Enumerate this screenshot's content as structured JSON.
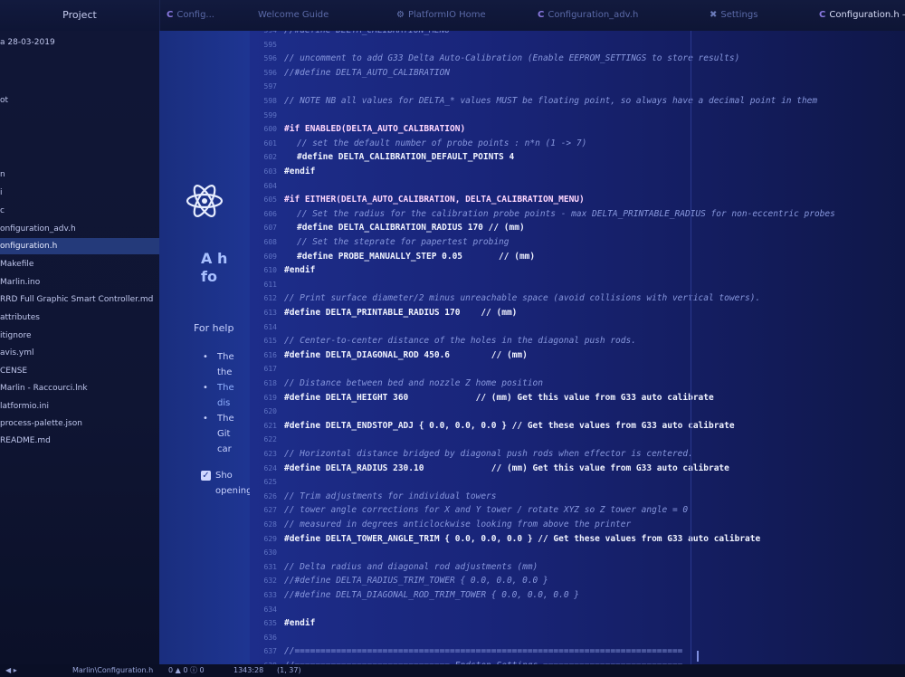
{
  "tabs": {
    "project": "Project",
    "items": [
      {
        "label": "Config...",
        "icon": "c-file-icon"
      },
      {
        "label": "Welcome Guide",
        "icon": ""
      },
      {
        "label": "PlatformIO Home",
        "icon": "platformio-icon"
      },
      {
        "label": "Configuration_adv.h",
        "icon": "c-file-icon"
      },
      {
        "label": "Settings",
        "icon": "gear-icon"
      },
      {
        "label": "Configuration.h —",
        "icon": "c-file-icon"
      }
    ]
  },
  "sidebar": {
    "items": [
      {
        "label": "a 28-03-2019",
        "selected": false
      },
      {
        "label": "ot",
        "selected": false
      },
      {
        "label": "n",
        "selected": false
      },
      {
        "label": "i",
        "selected": false
      },
      {
        "label": "c",
        "selected": false
      },
      {
        "label": "onfiguration_adv.h",
        "selected": false
      },
      {
        "label": "onfiguration.h",
        "selected": true
      },
      {
        "label": "Makefile",
        "selected": false
      },
      {
        "label": "Marlin.ino",
        "selected": false
      },
      {
        "label": "RRD Full Graphic Smart Controller.md",
        "selected": false
      },
      {
        "label": "attributes",
        "selected": false
      },
      {
        "label": "itignore",
        "selected": false
      },
      {
        "label": "avis.yml",
        "selected": false
      },
      {
        "label": "CENSE",
        "selected": false
      },
      {
        "label": "Marlin - Raccourci.lnk",
        "selected": false
      },
      {
        "label": "latformio.ini",
        "selected": false
      },
      {
        "label": "process-palette.json",
        "selected": false
      },
      {
        "label": "README.md",
        "selected": false
      }
    ]
  },
  "welcome": {
    "title": "A h\nfo",
    "for_help": "For help",
    "bullets": [
      "The\nthe",
      "The\ndis",
      "The\nGit\ncar"
    ],
    "checkbox_label": "Sho\nopening"
  },
  "editor": {
    "lines": [
      {
        "num": "594",
        "text": "//#define DELTA_CALIBRATION_MENU",
        "kind": "cm",
        "indent": 0
      },
      {
        "num": "595",
        "text": "",
        "kind": "code",
        "indent": 0
      },
      {
        "num": "596",
        "text": "// uncomment to add G33 Delta Auto-Calibration (Enable EEPROM_SETTINGS to store results)",
        "kind": "cm",
        "indent": 0
      },
      {
        "num": "596",
        "text": "//#define DELTA_AUTO_CALIBRATION",
        "kind": "cm",
        "indent": 0
      },
      {
        "num": "597",
        "text": "",
        "kind": "code",
        "indent": 0
      },
      {
        "num": "598",
        "text": "// NOTE NB all values for DELTA_* values MUST be floating point, so always have a decimal point in them",
        "kind": "cm",
        "indent": 0
      },
      {
        "num": "599",
        "text": "",
        "kind": "code",
        "indent": 0
      },
      {
        "num": "600",
        "text": "#if ENABLED(DELTA_AUTO_CALIBRATION)",
        "kind": "kw",
        "indent": 0
      },
      {
        "num": "601",
        "text": "// set the default number of probe points : n*n (1 -> 7)",
        "kind": "cm",
        "indent": 1
      },
      {
        "num": "602",
        "text": "#define DELTA_CALIBRATION_DEFAULT_POINTS 4",
        "kind": "pp",
        "indent": 1
      },
      {
        "num": "603",
        "text": "#endif",
        "kind": "pp",
        "indent": 0
      },
      {
        "num": "604",
        "text": "",
        "kind": "code",
        "indent": 0
      },
      {
        "num": "605",
        "text": "#if EITHER(DELTA_AUTO_CALIBRATION, DELTA_CALIBRATION_MENU)",
        "kind": "kw",
        "indent": 0
      },
      {
        "num": "606",
        "text": "// Set the radius for the calibration probe points - max DELTA_PRINTABLE_RADIUS for non-eccentric probes",
        "kind": "cm",
        "indent": 1
      },
      {
        "num": "607",
        "text": "#define DELTA_CALIBRATION_RADIUS 170 // (mm)",
        "kind": "pp",
        "indent": 1
      },
      {
        "num": "608",
        "text": "// Set the steprate for papertest probing",
        "kind": "cm",
        "indent": 1
      },
      {
        "num": "609",
        "text": "#define PROBE_MANUALLY_STEP 0.05       // (mm)",
        "kind": "pp",
        "indent": 1
      },
      {
        "num": "610",
        "text": "#endif",
        "kind": "pp",
        "indent": 0
      },
      {
        "num": "611",
        "text": "",
        "kind": "code",
        "indent": 0
      },
      {
        "num": "612",
        "text": "// Print surface diameter/2 minus unreachable space (avoid collisions with vertical towers).",
        "kind": "cm",
        "indent": 0
      },
      {
        "num": "613",
        "text": "#define DELTA_PRINTABLE_RADIUS 170    // (mm)",
        "kind": "pp",
        "indent": 0
      },
      {
        "num": "614",
        "text": "",
        "kind": "code",
        "indent": 0
      },
      {
        "num": "615",
        "text": "// Center-to-center distance of the holes in the diagonal push rods.",
        "kind": "cm",
        "indent": 0
      },
      {
        "num": "616",
        "text": "#define DELTA_DIAGONAL_ROD 450.6        // (mm)",
        "kind": "pp",
        "indent": 0
      },
      {
        "num": "617",
        "text": "",
        "kind": "code",
        "indent": 0
      },
      {
        "num": "618",
        "text": "// Distance between bed and nozzle Z home position",
        "kind": "cm",
        "indent": 0
      },
      {
        "num": "619",
        "text": "#define DELTA_HEIGHT 360             // (mm) Get this value from G33 auto calibrate",
        "kind": "pp",
        "indent": 0
      },
      {
        "num": "620",
        "text": "",
        "kind": "code",
        "indent": 0
      },
      {
        "num": "621",
        "text": "#define DELTA_ENDSTOP_ADJ { 0.0, 0.0, 0.0 } // Get these values from G33 auto calibrate",
        "kind": "pp",
        "indent": 0
      },
      {
        "num": "622",
        "text": "",
        "kind": "code",
        "indent": 0
      },
      {
        "num": "623",
        "text": "// Horizontal distance bridged by diagonal push rods when effector is centered.",
        "kind": "cm",
        "indent": 0
      },
      {
        "num": "624",
        "text": "#define DELTA_RADIUS 230.10             // (mm) Get this value from G33 auto calibrate",
        "kind": "pp",
        "indent": 0
      },
      {
        "num": "625",
        "text": "",
        "kind": "code",
        "indent": 0
      },
      {
        "num": "626",
        "text": "// Trim adjustments for individual towers",
        "kind": "cm",
        "indent": 0
      },
      {
        "num": "627",
        "text": "// tower angle corrections for X and Y tower / rotate XYZ so Z tower angle = 0",
        "kind": "cm",
        "indent": 0
      },
      {
        "num": "628",
        "text": "// measured in degrees anticlockwise looking from above the printer",
        "kind": "cm",
        "indent": 0
      },
      {
        "num": "629",
        "text": "#define DELTA_TOWER_ANGLE_TRIM { 0.0, 0.0, 0.0 } // Get these values from G33 auto calibrate",
        "kind": "pp",
        "indent": 0
      },
      {
        "num": "630",
        "text": "",
        "kind": "code",
        "indent": 0
      },
      {
        "num": "631",
        "text": "// Delta radius and diagonal rod adjustments (mm)",
        "kind": "cm",
        "indent": 0
      },
      {
        "num": "632",
        "text": "//#define DELTA_RADIUS_TRIM_TOWER { 0.0, 0.0, 0.0 }",
        "kind": "cm",
        "indent": 0
      },
      {
        "num": "633",
        "text": "//#define DELTA_DIAGONAL_ROD_TRIM_TOWER { 0.0, 0.0, 0.0 }",
        "kind": "cm",
        "indent": 0
      },
      {
        "num": "634",
        "text": "",
        "kind": "code",
        "indent": 0
      },
      {
        "num": "635",
        "text": "#endif",
        "kind": "pp",
        "indent": 0
      },
      {
        "num": "636",
        "text": "",
        "kind": "code",
        "indent": 0
      },
      {
        "num": "637",
        "text": "//===========================================================================",
        "kind": "cm",
        "indent": 0
      },
      {
        "num": "638",
        "text": "//============================== Endstop Settings ===========================",
        "kind": "cm",
        "indent": 0
      }
    ]
  },
  "status": {
    "file": "Marlin\\Configuration.h",
    "problems": "0 ▲ 0 ⓘ 0",
    "cursor": "1343:28",
    "selection": "(1, 37)"
  }
}
